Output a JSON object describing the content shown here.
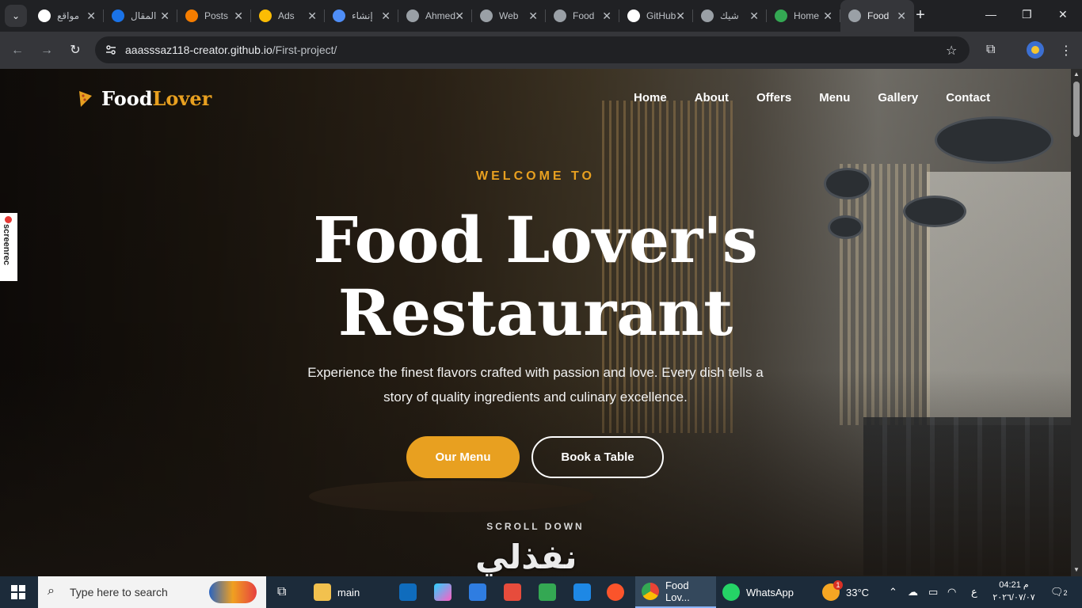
{
  "browser": {
    "tabs": [
      {
        "title": "مواقع",
        "favicon": "google-icon",
        "color": "#ffffff"
      },
      {
        "title": "المقال",
        "favicon": "blue-logo-icon",
        "color": "#1a73e8"
      },
      {
        "title": "Posts",
        "favicon": "blogger-icon",
        "color": "#f57d00"
      },
      {
        "title": "Ads",
        "favicon": "google-ads-icon",
        "color": "#fbbc04"
      },
      {
        "title": "إنشاء",
        "favicon": "gemini-icon",
        "color": "#4f8ef7"
      },
      {
        "title": "Ahmed",
        "favicon": "globe-icon",
        "color": "#9aa0a6"
      },
      {
        "title": "Web",
        "favicon": "globe-icon",
        "color": "#9aa0a6"
      },
      {
        "title": "Food",
        "favicon": "globe-icon",
        "color": "#9aa0a6"
      },
      {
        "title": "GitHub",
        "favicon": "github-icon",
        "color": "#ffffff"
      },
      {
        "title": "شيك",
        "favicon": "globe-icon",
        "color": "#9aa0a6"
      },
      {
        "title": "Home",
        "favicon": "google-drive-icon",
        "color": "#34a853"
      },
      {
        "title": "Food",
        "favicon": "globe-icon",
        "color": "#9aa0a6",
        "active": true
      }
    ],
    "url_host": "aaasssaz118-creator.github.io",
    "url_path": "/First-project/"
  },
  "site": {
    "brand_main": "Food",
    "brand_accent": "Lover",
    "nav": [
      "Home",
      "About",
      "Offers",
      "Menu",
      "Gallery",
      "Contact"
    ],
    "welcome": "WELCOME TO",
    "title_line1": "Food Lover's",
    "title_line2": "Restaurant",
    "description": "Experience the finest flavors crafted with passion and love. Every dish tells a story of quality ingredients and culinary excellence.",
    "btn_menu": "Our Menu",
    "btn_book": "Book a Table",
    "scroll_down": "SCROLL DOWN",
    "accent_color": "#e8a020"
  },
  "overlays": {
    "screenrec_label": "screenrec",
    "watermark": "نفذلي"
  },
  "taskbar": {
    "search_placeholder": "Type here to search",
    "folder_label": "main",
    "chrome_label": "Food Lov...",
    "whatsapp_label": "WhatsApp",
    "weather_temp": "33°C",
    "weather_badge": "1",
    "lang": "ع",
    "time": "04:21 م",
    "date": "٢٠٢٦/٠٧/٠٧",
    "notification_count": "2"
  }
}
